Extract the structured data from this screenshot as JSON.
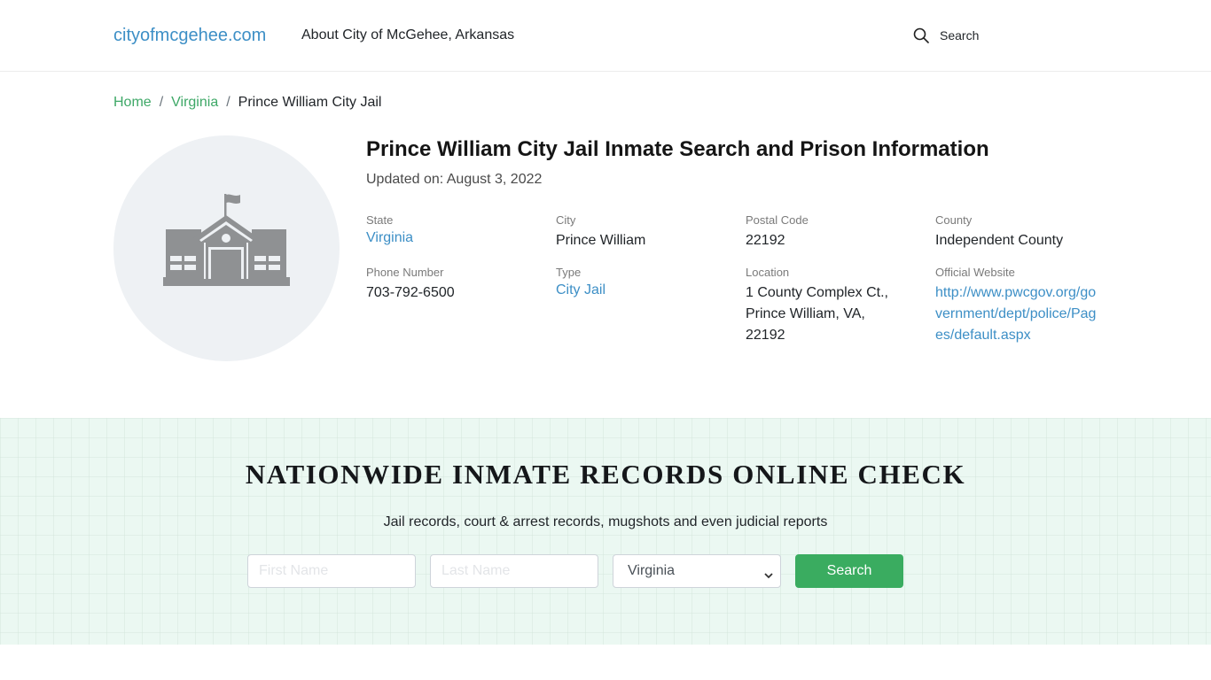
{
  "header": {
    "brand": "cityofmcgehee.com",
    "nav_about": "About City of McGehee, Arkansas",
    "search_label": "Search"
  },
  "breadcrumb": {
    "items": [
      "Home",
      "Virginia"
    ],
    "separator": "/",
    "current": "Prince William City Jail"
  },
  "facility": {
    "icon": "school-building-icon",
    "title": "Prince William City Jail Inmate Search and Prison Information",
    "updated": "Updated on: August 3, 2022",
    "fields": [
      {
        "label": "State",
        "value": "Virginia",
        "link": true
      },
      {
        "label": "City",
        "value": "Prince William",
        "link": false
      },
      {
        "label": "Postal Code",
        "value": "22192",
        "link": false
      },
      {
        "label": "County",
        "value": "Independent County",
        "link": false
      },
      {
        "label": "Phone Number",
        "value": "703-792-6500",
        "link": false
      },
      {
        "label": "Type",
        "value": "City Jail",
        "link": true
      },
      {
        "label": "Location",
        "value": "1 County Complex Ct., Prince William, VA, 22192",
        "link": false
      },
      {
        "label": "Official Website",
        "value": "http://www.pwcgov.org/government/dept/police/Pages/default.aspx",
        "link": true
      }
    ]
  },
  "cta": {
    "title": "NATIONWIDE INMATE RECORDS ONLINE CHECK",
    "subtitle": "Jail records, court & arrest records, mugshots and even judicial reports",
    "first_name_placeholder": "First Name",
    "last_name_placeholder": "Last Name",
    "state_selected": "Virginia",
    "search_button": "Search"
  },
  "colors": {
    "link_blue": "#3d8fc6",
    "breadcrumb_green": "#3ea867",
    "button_green": "#3aac60",
    "cta_bg": "#ebf8f2"
  }
}
